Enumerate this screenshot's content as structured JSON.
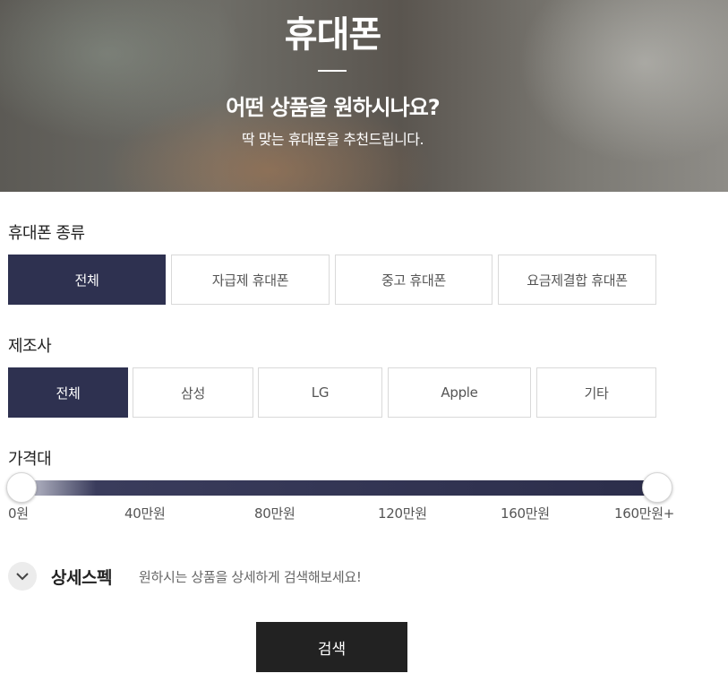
{
  "hero": {
    "title": "휴대폰",
    "subtitle": "어떤 상품을 원하시나요?",
    "description": "딱 맞는 휴대폰을 추천드립니다."
  },
  "phone_type": {
    "label": "휴대폰 종류",
    "options": [
      {
        "label": "전체",
        "active": true
      },
      {
        "label": "자급제 휴대폰",
        "active": false
      },
      {
        "label": "중고 휴대폰",
        "active": false
      },
      {
        "label": "요금제결합 휴대폰",
        "active": false
      }
    ]
  },
  "manufacturer": {
    "label": "제조사",
    "options": [
      {
        "label": "전체",
        "active": true
      },
      {
        "label": "삼성",
        "active": false
      },
      {
        "label": "LG",
        "active": false
      },
      {
        "label": "Apple",
        "active": false
      },
      {
        "label": "기타",
        "active": false
      }
    ]
  },
  "price": {
    "label": "가격대",
    "ticks": [
      "0원",
      "40만원",
      "80만원",
      "120만원",
      "160만원",
      "160만원+"
    ],
    "selected_min_index": 0,
    "selected_max_index": 5
  },
  "spec": {
    "title": "상세스펙",
    "description": "원하시는 상품을 상세하게 검색해보세요!",
    "toggle_icon": "chevron-down-icon"
  },
  "search_button": {
    "label": "검색"
  },
  "colors": {
    "active_chip": "#2e3150",
    "search_button": "#222222"
  }
}
